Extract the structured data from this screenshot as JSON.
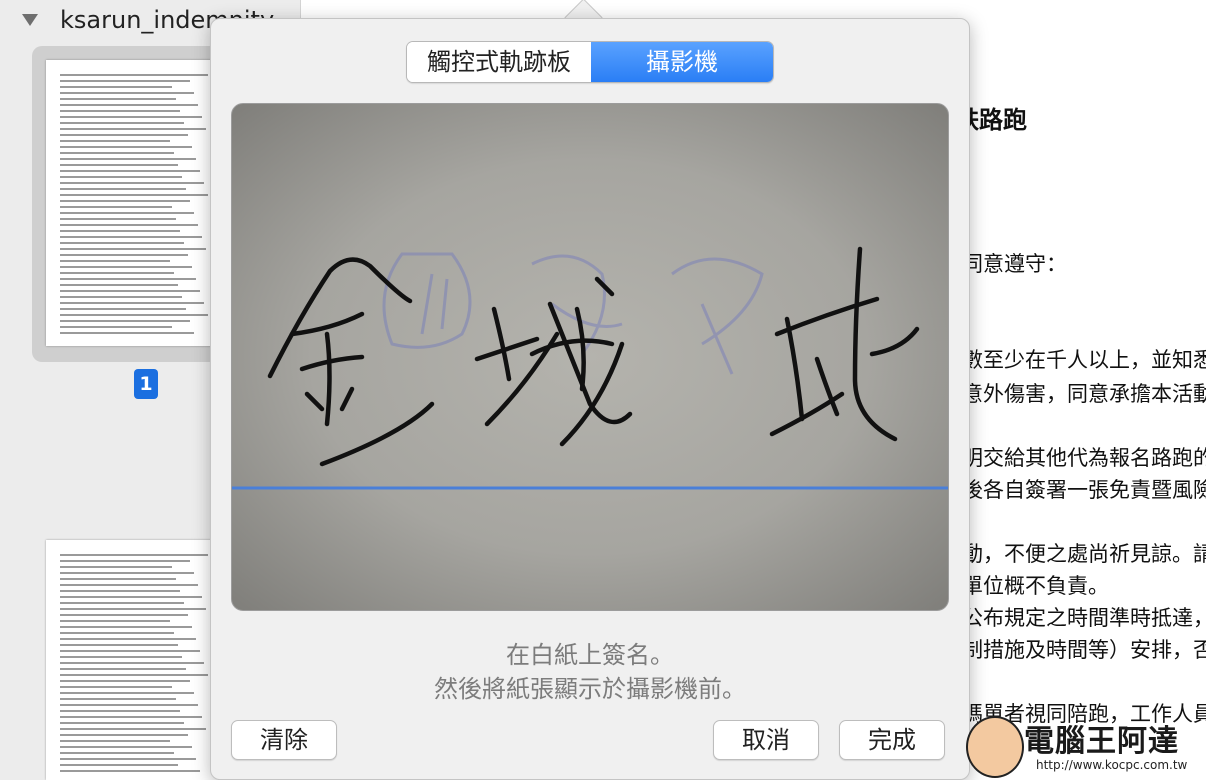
{
  "sidebar": {
    "file_name": "ksarun_indemnity",
    "page_number": "1"
  },
  "document": {
    "title_fragment": "跌路跑",
    "lines": [
      "同意遵守：",
      "數至少在千人以上，並知悉參",
      "意外傷害，同意承擔本活動可",
      "明交給其他代為報名路跑的隊",
      "後各自簽署一張免責暨風險聲",
      "動，不便之處尚祈見諒。請勿",
      "單位概不負責。",
      "公布規定之時間準時抵達，活",
      "制措施及時間等）安排，否則",
      "媽單者視同陪跑，工作人員有"
    ]
  },
  "signature_popover": {
    "tabs": [
      {
        "label": "觸控式軌跡板",
        "selected": false
      },
      {
        "label": "攝影機",
        "selected": true
      }
    ],
    "instruction_line1": "在白紙上簽名。",
    "instruction_line2": "然後將紙張顯示於攝影機前。",
    "clear_label": "清除",
    "cancel_label": "取消",
    "done_label": "完成",
    "captured_signature_text": "金城武",
    "baseline_color": "#4a7fd8",
    "stroke_color": "#111111"
  },
  "watermark": {
    "text": "電腦王阿達",
    "url": "http://www.kocpc.com.tw"
  }
}
